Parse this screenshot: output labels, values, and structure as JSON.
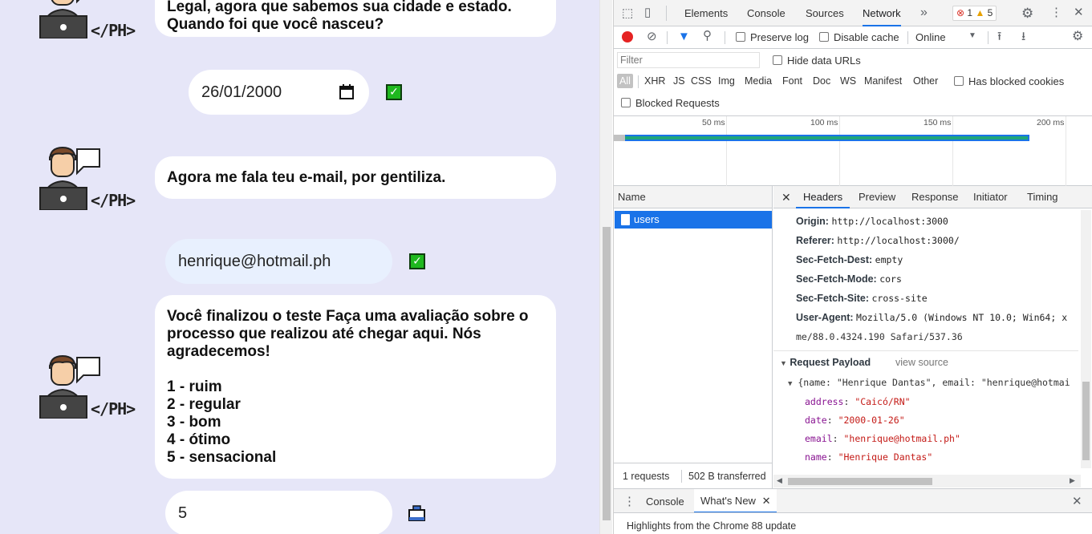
{
  "chat": {
    "bubbles": [
      {
        "lines": [
          "Legal, agora que sabemos sua cidade e estado.",
          "Quando foi que você nasceu?"
        ]
      },
      {
        "lines": [
          "Agora me fala teu e-mail, por gentiliza."
        ]
      },
      {
        "lines": [
          "Você finalizou o teste Faça uma avaliação sobre o",
          "processo que realizou até chegar aqui. Nós",
          "agradecemos!",
          "",
          "1 - ruim",
          "2 - regular",
          "3 - bom",
          "4 - ótimo",
          "5 - sensacional"
        ]
      }
    ],
    "bot_tag": "</PH>",
    "answers": {
      "date": "26/01/2000",
      "email": "henrique@hotmail.ph",
      "rating": "5"
    }
  },
  "devtools": {
    "tabs": [
      "Elements",
      "Console",
      "Sources",
      "Network"
    ],
    "active_tab": "Network",
    "errors": "1",
    "warnings": "5",
    "toolbar": {
      "preserve_log": "Preserve log",
      "disable_cache": "Disable cache",
      "throttle": "Online"
    },
    "filter": {
      "placeholder": "Filter",
      "hide_data_urls": "Hide data URLs",
      "types": [
        "All",
        "XHR",
        "JS",
        "CSS",
        "Img",
        "Media",
        "Font",
        "Doc",
        "WS",
        "Manifest",
        "Other"
      ],
      "has_blocked_cookies": "Has blocked cookies",
      "blocked_requests": "Blocked Requests"
    },
    "timeline_ticks": [
      "50 ms",
      "100 ms",
      "150 ms",
      "200 ms"
    ],
    "name_header": "Name",
    "request_name": "users",
    "summary": {
      "requests": "1 requests",
      "transferred": "502 B transferred"
    },
    "detail_tabs": [
      "Headers",
      "Preview",
      "Response",
      "Initiator",
      "Timing"
    ],
    "active_detail_tab": "Headers",
    "headers": [
      {
        "k": "Origin:",
        "v": "http://localhost:3000"
      },
      {
        "k": "Referer:",
        "v": "http://localhost:3000/"
      },
      {
        "k": "Sec-Fetch-Dest:",
        "v": "empty"
      },
      {
        "k": "Sec-Fetch-Mode:",
        "v": "cors"
      },
      {
        "k": "Sec-Fetch-Site:",
        "v": "cross-site"
      },
      {
        "k": "User-Agent:",
        "v": "Mozilla/5.0 (Windows NT 10.0; Win64; x"
      }
    ],
    "ua_cont": "me/88.0.4324.190 Safari/537.36",
    "payload": {
      "title": "Request Payload",
      "view_source": "view source",
      "summary": "{name: \"Henrique Dantas\", email: \"henrique@hotmai",
      "fields": [
        {
          "k": "address",
          "v": "\"Caicó/RN\""
        },
        {
          "k": "date",
          "v": "\"2000-01-26\""
        },
        {
          "k": "email",
          "v": "\"henrique@hotmail.ph\""
        },
        {
          "k": "name",
          "v": "\"Henrique Dantas\""
        }
      ]
    },
    "drawer": {
      "tabs": [
        "Console",
        "What's New"
      ],
      "active": "What's New",
      "body": "Highlights from the Chrome 88 update"
    }
  }
}
